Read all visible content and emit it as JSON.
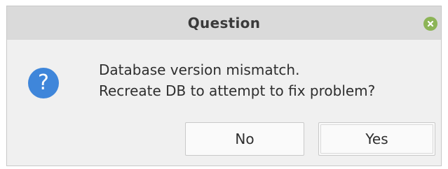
{
  "dialog": {
    "title": "Question",
    "close_icon": "close-icon",
    "icon": "question-icon",
    "icon_glyph": "?",
    "message_lines": [
      "Database version mismatch.",
      "Recreate DB to attempt to fix problem?"
    ],
    "buttons": {
      "no_label": "No",
      "yes_label": "Yes"
    }
  },
  "colors": {
    "titlebar_bg": "#dadada",
    "dialog_bg": "#f0f0f0",
    "close_button": "#8cb456",
    "question_icon": "#3f86da"
  }
}
